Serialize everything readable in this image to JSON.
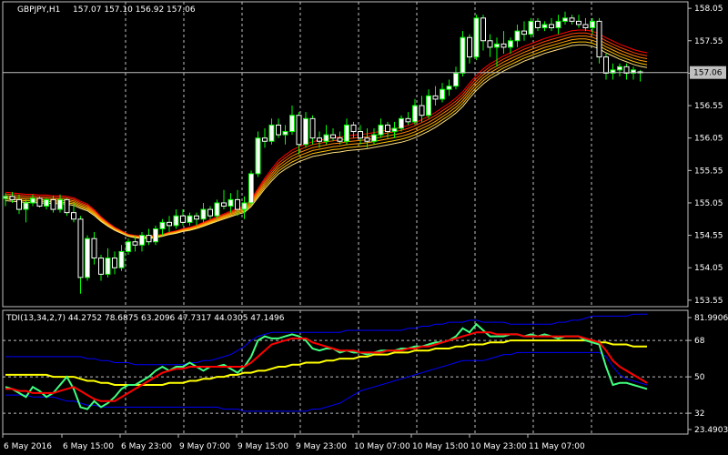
{
  "window": {
    "symbol_label": "GBPJPY,H1",
    "ohlc_values": "157.07 157.10 156.92 157.06",
    "current_price": "157.06"
  },
  "colors": {
    "background": "#000000",
    "frame": "#c0c0c0",
    "grid": "#c0c0c0",
    "bull_candle": "#ffffff",
    "bull_candle_border": "#00ff00",
    "bear_candle": "#000000",
    "bear_candle_border": "#ffffff",
    "wick": "#00ff00",
    "price_line": "#c0c0c0",
    "tdi_rsi": "#40ff80",
    "tdi_signal": "#ff0000",
    "tdi_market_base": "#ffff00",
    "tdi_bands": "#0000ff",
    "ribbon": [
      "#ff0000",
      "#ff4000",
      "#ff8000",
      "#ffa000",
      "#ffc000",
      "#ffe080"
    ]
  },
  "chart_data": {
    "type": "candlestick",
    "time_labels": [
      "6 May 2016",
      "6 May 15:00",
      "6 May 23:00",
      "9 May 07:00",
      "9 May 15:00",
      "9 May 23:00",
      "10 May 07:00",
      "10 May 15:00",
      "10 May 23:00",
      "11 May 07:00"
    ],
    "price_axis": {
      "ticks": [
        "158.05",
        "157.55",
        "157.05",
        "156.55",
        "156.05",
        "155.55",
        "155.05",
        "154.55",
        "154.05",
        "153.55"
      ],
      "ylim": [
        153.45,
        158.15
      ],
      "current": 157.06
    },
    "candles": [
      [
        155.12,
        155.2,
        155.0,
        155.15
      ],
      [
        155.15,
        155.22,
        155.05,
        155.1
      ],
      [
        155.1,
        155.18,
        154.88,
        154.95
      ],
      [
        154.95,
        155.1,
        154.75,
        155.05
      ],
      [
        155.05,
        155.18,
        155.0,
        155.12
      ],
      [
        155.12,
        155.15,
        154.98,
        155.0
      ],
      [
        155.0,
        155.12,
        154.95,
        155.1
      ],
      [
        155.1,
        155.16,
        154.9,
        154.95
      ],
      [
        154.95,
        155.18,
        154.9,
        155.1
      ],
      [
        155.1,
        155.12,
        154.85,
        154.9
      ],
      [
        154.9,
        155.05,
        154.75,
        154.8
      ],
      [
        154.8,
        154.85,
        153.65,
        153.9
      ],
      [
        153.9,
        154.55,
        153.85,
        154.5
      ],
      [
        154.5,
        154.6,
        154.1,
        154.2
      ],
      [
        154.2,
        154.25,
        153.85,
        153.95
      ],
      [
        153.95,
        154.35,
        153.9,
        154.2
      ],
      [
        154.2,
        154.3,
        153.95,
        154.05
      ],
      [
        154.05,
        154.4,
        154.0,
        154.3
      ],
      [
        154.3,
        154.5,
        154.25,
        154.45
      ],
      [
        154.45,
        154.55,
        154.3,
        154.4
      ],
      [
        154.4,
        154.6,
        154.3,
        154.55
      ],
      [
        154.55,
        154.65,
        154.4,
        154.45
      ],
      [
        154.45,
        154.7,
        154.4,
        154.65
      ],
      [
        154.65,
        154.8,
        154.55,
        154.75
      ],
      [
        154.75,
        154.85,
        154.6,
        154.7
      ],
      [
        154.7,
        154.95,
        154.65,
        154.85
      ],
      [
        154.85,
        154.95,
        154.7,
        154.75
      ],
      [
        154.75,
        154.9,
        154.7,
        154.85
      ],
      [
        154.85,
        154.9,
        154.7,
        154.8
      ],
      [
        154.8,
        155.05,
        154.75,
        154.95
      ],
      [
        154.95,
        155.0,
        154.8,
        154.85
      ],
      [
        154.85,
        155.1,
        154.8,
        155.05
      ],
      [
        155.05,
        155.25,
        154.95,
        155.0
      ],
      [
        155.0,
        155.2,
        154.9,
        155.1
      ],
      [
        155.1,
        155.25,
        154.85,
        154.95
      ],
      [
        154.95,
        155.15,
        154.8,
        155.05
      ],
      [
        155.05,
        155.55,
        155.0,
        155.5
      ],
      [
        155.5,
        156.15,
        155.45,
        156.05
      ],
      [
        156.05,
        156.2,
        155.9,
        156.0
      ],
      [
        156.0,
        156.35,
        155.95,
        156.25
      ],
      [
        156.25,
        156.35,
        156.05,
        156.1
      ],
      [
        156.1,
        156.25,
        155.95,
        156.15
      ],
      [
        156.15,
        156.55,
        156.1,
        156.4
      ],
      [
        156.4,
        156.45,
        155.8,
        155.95
      ],
      [
        155.95,
        156.45,
        155.9,
        156.35
      ],
      [
        156.35,
        156.4,
        155.95,
        156.05
      ],
      [
        156.05,
        156.15,
        155.9,
        156.0
      ],
      [
        156.0,
        156.25,
        155.95,
        156.1
      ],
      [
        156.1,
        156.2,
        156.0,
        156.05
      ],
      [
        156.05,
        156.15,
        155.95,
        156.0
      ],
      [
        156.0,
        156.35,
        155.95,
        156.25
      ],
      [
        156.25,
        156.3,
        156.05,
        156.15
      ],
      [
        156.15,
        156.25,
        155.95,
        156.05
      ],
      [
        156.05,
        156.2,
        155.9,
        156.0
      ],
      [
        156.0,
        156.2,
        155.95,
        156.1
      ],
      [
        156.1,
        156.35,
        156.05,
        156.25
      ],
      [
        156.25,
        156.3,
        156.05,
        156.15
      ],
      [
        156.15,
        156.3,
        156.05,
        156.2
      ],
      [
        156.2,
        156.4,
        156.15,
        156.35
      ],
      [
        156.35,
        156.45,
        156.25,
        156.3
      ],
      [
        156.3,
        156.65,
        156.25,
        156.55
      ],
      [
        156.55,
        156.7,
        156.3,
        156.4
      ],
      [
        156.4,
        156.8,
        156.35,
        156.7
      ],
      [
        156.7,
        156.85,
        156.55,
        156.65
      ],
      [
        156.65,
        156.9,
        156.6,
        156.8
      ],
      [
        156.8,
        156.95,
        156.7,
        156.85
      ],
      [
        156.85,
        157.15,
        156.8,
        157.05
      ],
      [
        157.05,
        157.7,
        157.0,
        157.6
      ],
      [
        157.6,
        157.65,
        157.2,
        157.3
      ],
      [
        157.3,
        157.95,
        157.25,
        157.9
      ],
      [
        157.9,
        157.95,
        157.4,
        157.55
      ],
      [
        157.55,
        157.65,
        157.3,
        157.45
      ],
      [
        157.45,
        157.6,
        157.15,
        157.5
      ],
      [
        157.5,
        157.7,
        157.35,
        157.45
      ],
      [
        157.45,
        157.6,
        157.35,
        157.55
      ],
      [
        157.55,
        157.8,
        157.45,
        157.7
      ],
      [
        157.7,
        157.85,
        157.55,
        157.65
      ],
      [
        157.65,
        157.9,
        157.6,
        157.85
      ],
      [
        157.85,
        157.9,
        157.7,
        157.75
      ],
      [
        157.75,
        157.85,
        157.7,
        157.8
      ],
      [
        157.8,
        157.9,
        157.7,
        157.75
      ],
      [
        157.75,
        157.95,
        157.65,
        157.85
      ],
      [
        157.85,
        158.0,
        157.8,
        157.9
      ],
      [
        157.9,
        157.95,
        157.8,
        157.85
      ],
      [
        157.85,
        157.95,
        157.75,
        157.8
      ],
      [
        157.8,
        157.9,
        157.7,
        157.75
      ],
      [
        157.75,
        157.9,
        157.65,
        157.85
      ],
      [
        157.85,
        157.9,
        157.2,
        157.3
      ],
      [
        157.3,
        157.35,
        156.95,
        157.05
      ],
      [
        157.05,
        157.2,
        156.95,
        157.1
      ],
      [
        157.1,
        157.2,
        157.0,
        157.15
      ],
      [
        157.15,
        157.2,
        156.95,
        157.05
      ],
      [
        157.05,
        157.15,
        156.95,
        157.1
      ],
      [
        157.07,
        157.1,
        156.92,
        157.06
      ]
    ],
    "ribbon_ma": [
      155.15,
      155.14,
      155.13,
      155.12,
      155.12,
      155.11,
      155.11,
      155.1,
      155.1,
      155.09,
      155.07,
      155.02,
      154.98,
      154.9,
      154.8,
      154.72,
      154.65,
      154.6,
      154.55,
      154.53,
      154.52,
      154.52,
      154.53,
      154.55,
      154.58,
      154.6,
      154.63,
      154.65,
      154.68,
      154.72,
      154.76,
      154.8,
      154.84,
      154.88,
      154.92,
      154.95,
      155.05,
      155.2,
      155.35,
      155.48,
      155.6,
      155.68,
      155.75,
      155.8,
      155.84,
      155.88,
      155.9,
      155.92,
      155.94,
      155.95,
      155.97,
      155.98,
      155.99,
      156.0,
      156.02,
      156.04,
      156.06,
      156.08,
      156.1,
      156.13,
      156.17,
      156.22,
      156.27,
      156.33,
      156.4,
      156.47,
      156.55,
      156.65,
      156.78,
      156.9,
      157.0,
      157.08,
      157.14,
      157.2,
      157.25,
      157.3,
      157.35,
      157.39,
      157.43,
      157.47,
      157.5,
      157.53,
      157.56,
      157.59,
      157.6,
      157.6,
      157.58,
      157.54,
      157.48,
      157.43,
      157.38,
      157.34,
      157.3,
      157.27,
      157.25
    ],
    "tdi": {
      "label": "TDI(13,34,2,7) 44.2752 78.6875 63.2096 47.7317 44.0305 47.1496",
      "axis_ticks": [
        "81.9906",
        "68",
        "50",
        "32",
        "23.4903"
      ],
      "ylim": [
        23.4903,
        81.9906
      ],
      "levels": [
        68,
        50,
        32
      ],
      "rsi": [
        45,
        44,
        42,
        40,
        45,
        43,
        40,
        42,
        46,
        50,
        44,
        35,
        34,
        38,
        35,
        37,
        40,
        44,
        46,
        46,
        48,
        50,
        53,
        55,
        53,
        55,
        55,
        57,
        55,
        53,
        55,
        55,
        56,
        54,
        52,
        55,
        60,
        68,
        70,
        69,
        69,
        70,
        71,
        70,
        68,
        64,
        63,
        64,
        64,
        62,
        63,
        62,
        62,
        61,
        62,
        63,
        63,
        63,
        64,
        64,
        65,
        65,
        66,
        67,
        67,
        68,
        70,
        74,
        72,
        76,
        73,
        70,
        70,
        70,
        71,
        71,
        70,
        71,
        70,
        71,
        70,
        69,
        70,
        70,
        70,
        68,
        67,
        66,
        55,
        46,
        47,
        47,
        46,
        45,
        44
      ],
      "signal": [
        44,
        44,
        43,
        43,
        42,
        42,
        42,
        42,
        43,
        44,
        45,
        43,
        41,
        39,
        38,
        38,
        38,
        40,
        42,
        44,
        46,
        48,
        50,
        52,
        53,
        54,
        54,
        55,
        55,
        55,
        55,
        55,
        55,
        55,
        55,
        55,
        57,
        60,
        63,
        66,
        67,
        68,
        69,
        69,
        69,
        67,
        66,
        65,
        64,
        63,
        63,
        63,
        62,
        62,
        62,
        62,
        63,
        63,
        63,
        64,
        64,
        65,
        65,
        66,
        67,
        68,
        69,
        70,
        71,
        72,
        72,
        72,
        71,
        71,
        71,
        71,
        70,
        70,
        70,
        70,
        70,
        70,
        70,
        70,
        70,
        69,
        68,
        67,
        63,
        58,
        55,
        53,
        51,
        49,
        47
      ],
      "market_base": [
        51,
        51,
        51,
        51,
        51,
        51,
        51,
        50,
        50,
        50,
        50,
        49,
        48,
        48,
        47,
        47,
        46,
        46,
        46,
        46,
        46,
        46,
        46,
        46,
        47,
        47,
        47,
        48,
        48,
        49,
        49,
        50,
        50,
        51,
        51,
        52,
        52,
        53,
        53,
        54,
        55,
        55,
        56,
        56,
        57,
        57,
        57,
        58,
        58,
        59,
        59,
        59,
        60,
        60,
        61,
        61,
        61,
        62,
        62,
        62,
        63,
        63,
        63,
        64,
        64,
        64,
        65,
        65,
        66,
        66,
        66,
        67,
        67,
        67,
        68,
        68,
        68,
        68,
        68,
        68,
        68,
        68,
        68,
        68,
        68,
        68,
        68,
        67,
        67,
        66,
        66,
        66,
        65,
        65,
        65
      ],
      "band_upper": [
        60,
        60,
        60,
        60,
        60,
        60,
        60,
        60,
        60,
        60,
        60,
        60,
        59,
        59,
        58,
        58,
        57,
        57,
        57,
        56,
        56,
        56,
        56,
        56,
        56,
        56,
        56,
        57,
        57,
        58,
        58,
        59,
        60,
        61,
        63,
        65,
        68,
        70,
        71,
        72,
        72,
        72,
        72,
        72,
        72,
        72,
        72,
        72,
        72,
        72,
        73,
        73,
        73,
        73,
        73,
        73,
        73,
        73,
        73,
        74,
        74,
        75,
        75,
        76,
        76,
        77,
        77,
        77,
        78,
        78,
        77,
        77,
        77,
        77,
        76,
        76,
        76,
        76,
        76,
        76,
        76,
        77,
        77,
        78,
        78,
        79,
        80,
        80,
        80,
        80,
        80,
        80,
        81,
        81,
        81
      ],
      "band_lower": [
        41,
        41,
        41,
        41,
        40,
        40,
        40,
        40,
        39,
        38,
        38,
        37,
        36,
        36,
        35,
        35,
        35,
        35,
        35,
        35,
        35,
        35,
        35,
        35,
        35,
        35,
        35,
        35,
        35,
        35,
        35,
        35,
        34,
        34,
        34,
        33,
        33,
        33,
        33,
        33,
        33,
        33,
        33,
        33,
        33,
        34,
        34,
        35,
        36,
        37,
        39,
        41,
        43,
        44,
        45,
        46,
        47,
        48,
        49,
        50,
        51,
        52,
        53,
        54,
        55,
        56,
        57,
        58,
        58,
        58,
        58,
        59,
        60,
        61,
        61,
        62,
        62,
        62,
        62,
        62,
        62,
        62,
        62,
        62,
        62,
        62,
        62,
        62,
        60,
        55,
        51,
        49,
        48,
        47,
        46
      ]
    }
  }
}
